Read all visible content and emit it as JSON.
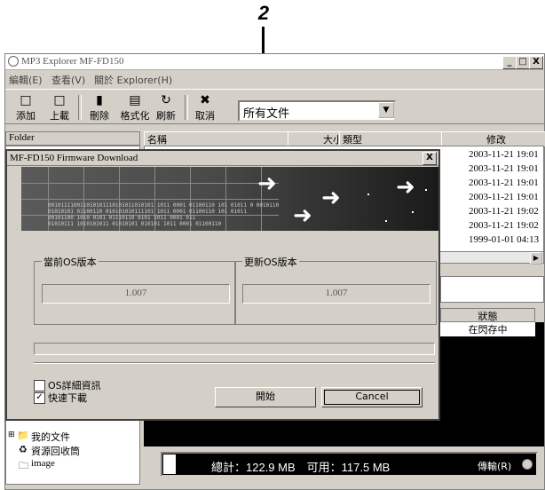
{
  "callout": {
    "number": "2"
  },
  "window": {
    "title": "MP3 Explorer MF-FD150",
    "controls": {
      "minimize": "_",
      "maximize": "□",
      "close": "X"
    }
  },
  "menu": [
    "編輯(E)",
    "查看(V)",
    "關於 Explorer(H)"
  ],
  "toolbar": {
    "buttons": [
      {
        "label": "添加",
        "icon": "add-file-icon"
      },
      {
        "label": "上載",
        "icon": "upload-icon"
      },
      {
        "label": "刪除",
        "icon": "delete-icon"
      },
      {
        "label": "格式化",
        "icon": "format-icon"
      },
      {
        "label": "刷新",
        "icon": "refresh-icon"
      },
      {
        "label": "取消",
        "icon": "cancel-icon"
      }
    ],
    "filter_value": "所有文件"
  },
  "folder_pane": {
    "header": "Folder",
    "items": [
      "我的文件",
      "資源回收筒",
      "image"
    ]
  },
  "file_list": {
    "columns": [
      "名稱",
      "大小",
      "類型",
      "修改"
    ],
    "dates": [
      "2003-11-21 19:01",
      "2003-11-21 19:01",
      "2003-11-21 19:01",
      "2003-11-21 19:01",
      "2003-11-21 19:02",
      "2003-11-21 19:02",
      "1999-01-01 04:13"
    ]
  },
  "queue": {
    "status_header": "狀態",
    "status_value": "在閃存中"
  },
  "storage": {
    "text": "總計：122.9 MB　可用：117.5 MB",
    "transfer_label": "傳輸(R)"
  },
  "dialog": {
    "title": "MF-FD150 Firmware Download",
    "current_os_label": "當前OS版本",
    "current_os_value": "1.007",
    "update_os_label": "更新OS版本",
    "update_os_value": "1.007",
    "os_details_label": "OS詳細資訊",
    "os_details_checked": false,
    "fast_download_label": "快速下載",
    "fast_download_checked": true,
    "start_button": "開始",
    "cancel_button": "Cancel",
    "banner_bits": [
      "001011110011010101110101011010101  1011 0001 01100110  101 01011 0 0010110",
      "01010101 01100110 010101010111101  1011 0001 01100110  101 01011",
      "00101100 1010 0101 01110110 0101  1011 0001 011",
      "01010111 1010101011 01010101 010101  1011 0001 01100110"
    ]
  }
}
